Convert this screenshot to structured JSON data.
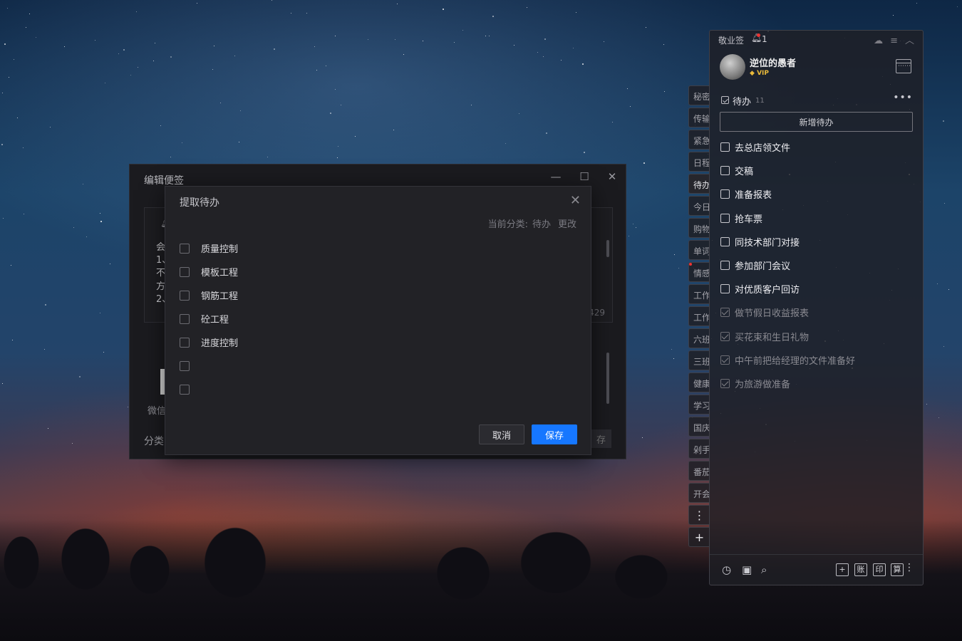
{
  "edit_window": {
    "title": "编辑便签",
    "content_lines": [
      "会",
      "1、",
      "不",
      "方",
      "2、"
    ],
    "char_count": "429",
    "wechat_label": "微信",
    "category_label": "分类",
    "save_label": "存",
    "controls": {
      "minimize": "—",
      "maximize": "☐",
      "close": "✕"
    }
  },
  "dialog": {
    "title": "提取待办",
    "close": "✕",
    "category_prefix": "当前分类:",
    "category_value": "待办",
    "change_label": "更改",
    "items": [
      {
        "label": "质量控制",
        "checked": false
      },
      {
        "label": "模板工程",
        "checked": false
      },
      {
        "label": "钢筋工程",
        "checked": false
      },
      {
        "label": "砼工程",
        "checked": false
      },
      {
        "label": "进度控制",
        "checked": false
      },
      {
        "label": "",
        "checked": false
      },
      {
        "label": "",
        "checked": false
      }
    ],
    "cancel_label": "取消",
    "save_label": "保存"
  },
  "side_tabs": [
    "秘密",
    "传输",
    "紧急",
    "日程",
    "待办",
    "今日",
    "购物",
    "单词",
    "情感",
    "工作",
    "工作",
    "六班",
    "三班",
    "健康",
    "学习",
    "国庆",
    "剁手",
    "番茄",
    "开会"
  ],
  "side_tab_more": "⋮",
  "side_tab_add": "+",
  "panel": {
    "app_name": "敬业签",
    "notification_count": "1",
    "username": "逆位的愚者",
    "vip_label": "VIP",
    "todo_title": "待办",
    "todo_count": "11",
    "todo_more": "•••",
    "new_todo_label": "新增待办",
    "todos": [
      {
        "text": "去总店领文件",
        "done": false
      },
      {
        "text": "交稿",
        "done": false
      },
      {
        "text": "准备报表",
        "done": false
      },
      {
        "text": "抢车票",
        "done": false
      },
      {
        "text": "同技术部门对接",
        "done": false
      },
      {
        "text": "参加部门会议",
        "done": false
      },
      {
        "text": "对优质客户回访",
        "done": false
      },
      {
        "text": "做节假日收益报表",
        "done": true
      },
      {
        "text": "买花束和生日礼物",
        "done": true
      },
      {
        "text": "中午前把给经理的文件准备好",
        "done": true
      },
      {
        "text": "为旅游做准备",
        "done": true
      }
    ],
    "footer_boxes": [
      "+",
      "账",
      "印",
      "算"
    ],
    "footer_more": "⋮"
  }
}
